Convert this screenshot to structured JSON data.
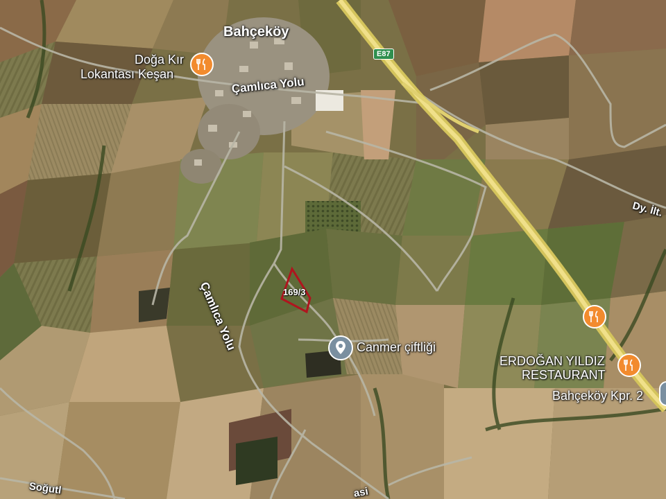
{
  "map": {
    "places": {
      "village": "Bahçeköy"
    },
    "roads": {
      "camlica_top": "Çamlıca Yolu",
      "camlica_side": "Çamlıca Yolu",
      "dy_road": "Dy. İlt.",
      "sogutlu": "Soğutl",
      "bottom_road": "asi"
    },
    "highway_shield": "E87",
    "parcel": {
      "label": "169/3",
      "outline_color": "#b0141e"
    },
    "pois": {
      "restaurant_1": {
        "name_line1": "Doğa Kır",
        "name_line2": "Lokantası Keşan",
        "icon": "restaurant-icon"
      },
      "restaurant_2": {
        "name_line1": "ERDOĞAN YILDIZ",
        "name_line2": "RESTAURANT",
        "icon": "restaurant-icon"
      },
      "farm": {
        "name": "Canmer çiftliği",
        "icon": "location-pin-icon"
      },
      "bridge": {
        "name": "Bahçeköy Kpr. 2"
      }
    },
    "colors": {
      "poi_orange": "#f28b2e",
      "highway": "#e8d66a",
      "road": "#b8b6a6"
    }
  }
}
